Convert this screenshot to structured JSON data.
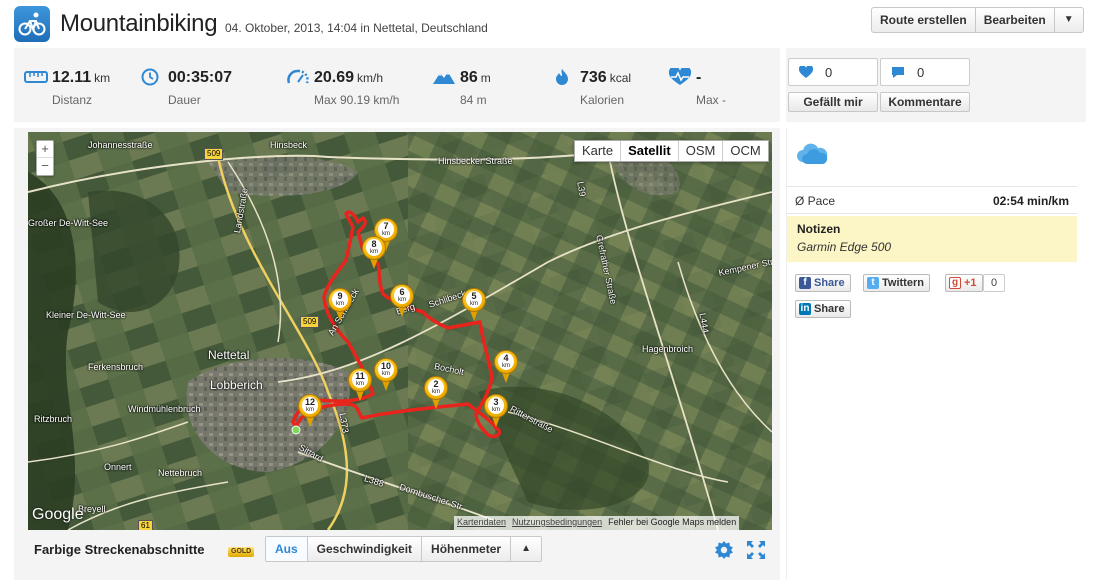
{
  "header": {
    "title": "Mountainbiking",
    "subtitle": "04. Oktober, 2013, 14:04 in Nettetal, Deutschland",
    "buttons": {
      "route": "Route erstellen",
      "edit": "Bearbeiten",
      "dropdown": "▼"
    }
  },
  "stats": {
    "distance": {
      "value": "12.11",
      "unit": "km",
      "label": "Distanz",
      "icon": "ruler-icon"
    },
    "duration": {
      "value": "00:35:07",
      "unit": "",
      "label": "Dauer",
      "icon": "clock-icon"
    },
    "speed": {
      "value": "20.69",
      "unit": "km/h",
      "label": "Max 90.19 km/h",
      "icon": "speedometer-icon"
    },
    "elevation": {
      "value": "86",
      "unit": "m",
      "label": "84 m",
      "icon": "mountain-icon"
    },
    "calories": {
      "value": "736",
      "unit": "kcal",
      "label": "Kalorien",
      "icon": "flame-icon"
    },
    "heartrate": {
      "value": "-",
      "unit": "",
      "label": "Max -",
      "icon": "heartrate-icon"
    }
  },
  "social": {
    "likes": "0",
    "comments": "0",
    "like_button": "Gefällt mir",
    "comment_button": "Kommentare"
  },
  "map": {
    "zoom_in": "+",
    "zoom_out": "−",
    "types": [
      "Karte",
      "Satellit",
      "OSM",
      "OCM"
    ],
    "active_type": "Satellit",
    "logo": "Google",
    "attribution": {
      "data": "Kartendaten",
      "terms": "Nutzungsbedingungen",
      "report": "Fehler bei Google Maps melden"
    },
    "places": [
      "Johannesstraße",
      "Hinsbeck",
      "Hinsbecker Straße",
      "Landstraße",
      "Kleiner De-Witt-See",
      "Großer De-Witt-See",
      "Ferkensbruch",
      "Windmühlenbruch",
      "Ritzbruch",
      "Nettetal",
      "Lobberich",
      "Onnert",
      "Nettebruch",
      "Breyell",
      "Sittard",
      "Dornbuscher Str.",
      "L388",
      "L373",
      "L39",
      "Grefrather Straße",
      "Kempener Str.",
      "Hagenbroich",
      "L444",
      "Ritterstraße",
      "Bocholt",
      "An Schlibeck",
      "Berg",
      "Schlibeck",
      "509",
      "61"
    ],
    "km_markers": [
      "2",
      "3",
      "4",
      "5",
      "6",
      "7",
      "8",
      "9",
      "10",
      "11",
      "12"
    ],
    "km_unit": "km"
  },
  "map_footer": {
    "title": "Farbige Streckenabschnitte",
    "badge": "GOLD",
    "options": [
      "Aus",
      "Geschwindigkeit",
      "Höhenmeter"
    ],
    "active_option": "Aus",
    "toggle": "▲"
  },
  "detail": {
    "weather_icon": "cloud-icon",
    "pace_label": "Ø Pace",
    "pace_value": "02:54 min/km",
    "notes_title": "Notizen",
    "notes_text": "Garmin Edge 500",
    "share": {
      "facebook": "Share",
      "twitter": "Twittern",
      "gplus": "+1",
      "gplus_count": "0",
      "linkedin": "Share"
    }
  },
  "colors": {
    "accent": "#2f88d4",
    "route": "#e8241c",
    "marker": "#f4b400",
    "notes_bg": "#fcf5c6"
  }
}
